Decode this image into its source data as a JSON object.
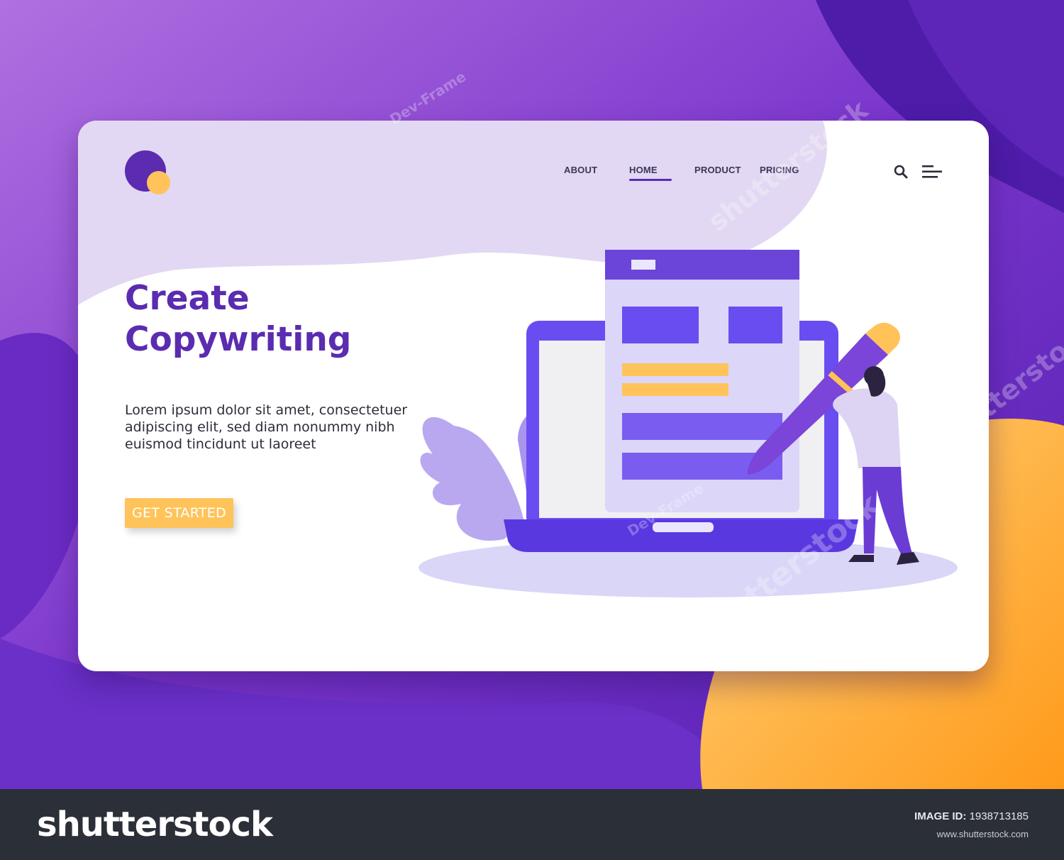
{
  "colors": {
    "primary": "#5b2bb0",
    "accent": "#ffc35a",
    "background": "#5a22b8",
    "footer": "#2b2f38"
  },
  "nav": {
    "items": [
      {
        "label": "ABOUT",
        "active": false
      },
      {
        "label": "HOME",
        "active": true
      },
      {
        "label": "PRODUCT",
        "active": false
      },
      {
        "label": "PRICING",
        "active": false
      }
    ],
    "search_icon": "search-icon",
    "menu_icon": "hamburger-menu-icon"
  },
  "hero": {
    "title_line1": "Create",
    "title_line2": "Copywriting",
    "body_line1": "Lorem ipsum dolor sit amet, consectetuer",
    "body_line2": "adipiscing elit, sed diam nonummy nibh",
    "body_line3": "euismod tincidunt ut laoreet",
    "cta_label": "GET STARTED"
  },
  "watermark": {
    "brand": "shutterstock",
    "author": "Dev-Frame"
  },
  "footer": {
    "logo_text": "shutterstock",
    "image_id_label": "IMAGE ID:",
    "image_id_value": "1938713185",
    "url": "www.shutterstock.com"
  }
}
